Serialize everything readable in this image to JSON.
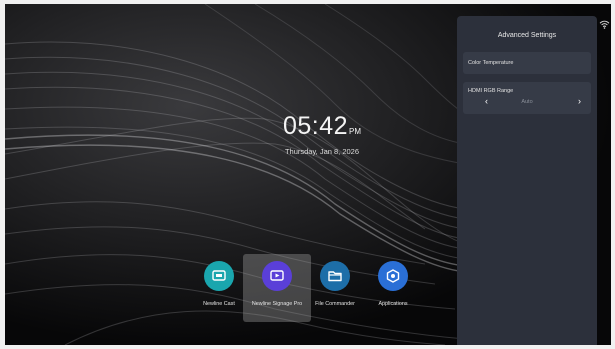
{
  "clock": {
    "time": "05:42",
    "ampm": "PM",
    "date": "Thursday, Jan 8, 2026"
  },
  "apps": [
    {
      "label": "Newline Cast",
      "icon": "cast-icon",
      "color": "#1aa6ae"
    },
    {
      "label": "Newline Signage Pro",
      "icon": "signage-icon",
      "color": "#5a3fd8",
      "selected": true
    },
    {
      "label": "File Commander",
      "icon": "folder-icon",
      "color": "#1d6ea8"
    },
    {
      "label": "Applications",
      "icon": "apps-hexagon-icon",
      "color": "#2a6fd6"
    }
  ],
  "advanced_settings": {
    "title": "Advanced Settings",
    "color_temperature_label": "Color Temperature",
    "hdmi_rgb_range": {
      "label": "HDMI RGB Range",
      "value": "Auto",
      "prev": "‹",
      "next": "›"
    }
  },
  "status": {
    "wifi_icon": "wifi-icon"
  }
}
